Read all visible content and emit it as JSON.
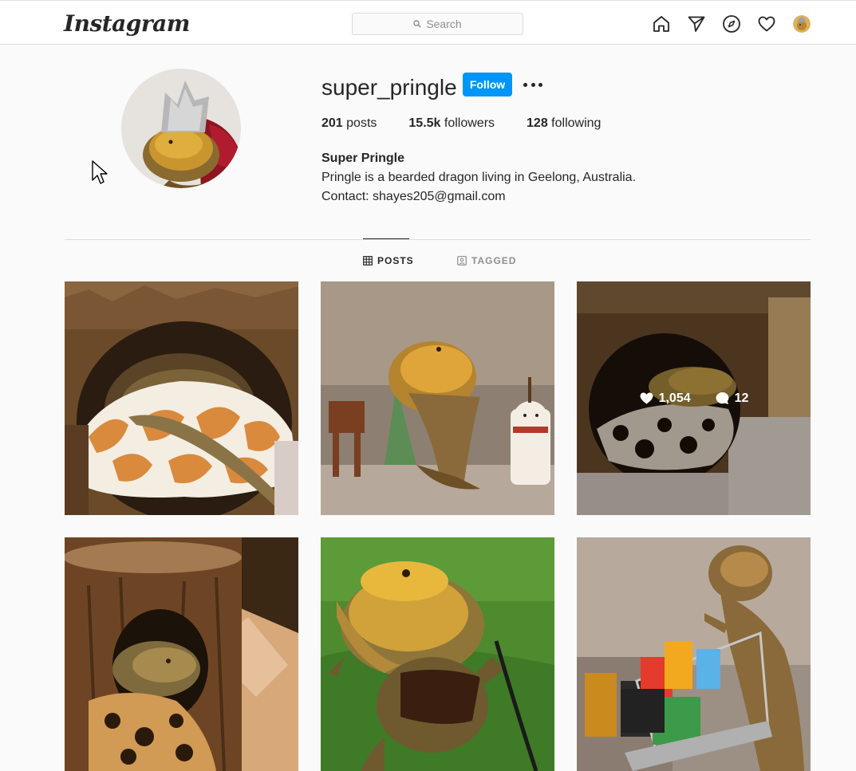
{
  "nav": {
    "logo": "Instagram",
    "search_placeholder": "Search",
    "icons": [
      "home-icon",
      "direct-icon",
      "explore-icon",
      "activity-heart-icon",
      "profile-avatar"
    ]
  },
  "profile": {
    "username": "super_pringle",
    "follow_label": "Follow",
    "stats": {
      "posts_count": "201",
      "posts_label": " posts",
      "followers_count": "15.5k",
      "followers_label": " followers",
      "following_count": "128",
      "following_label": " following"
    },
    "full_name": "Super Pringle",
    "bio_line1": "Pringle is a bearded dragon living in Geelong, Australia.",
    "bio_line2": "Contact: shayes205@gmail.com"
  },
  "tabs": [
    {
      "label": "POSTS",
      "active": true
    },
    {
      "label": "TAGGED",
      "active": false
    }
  ],
  "hovered_post": {
    "likes": "1,054",
    "comments": "12"
  },
  "colors": {
    "accent": "#0095f6",
    "border": "#dbdbdb",
    "background": "#fafafa"
  }
}
